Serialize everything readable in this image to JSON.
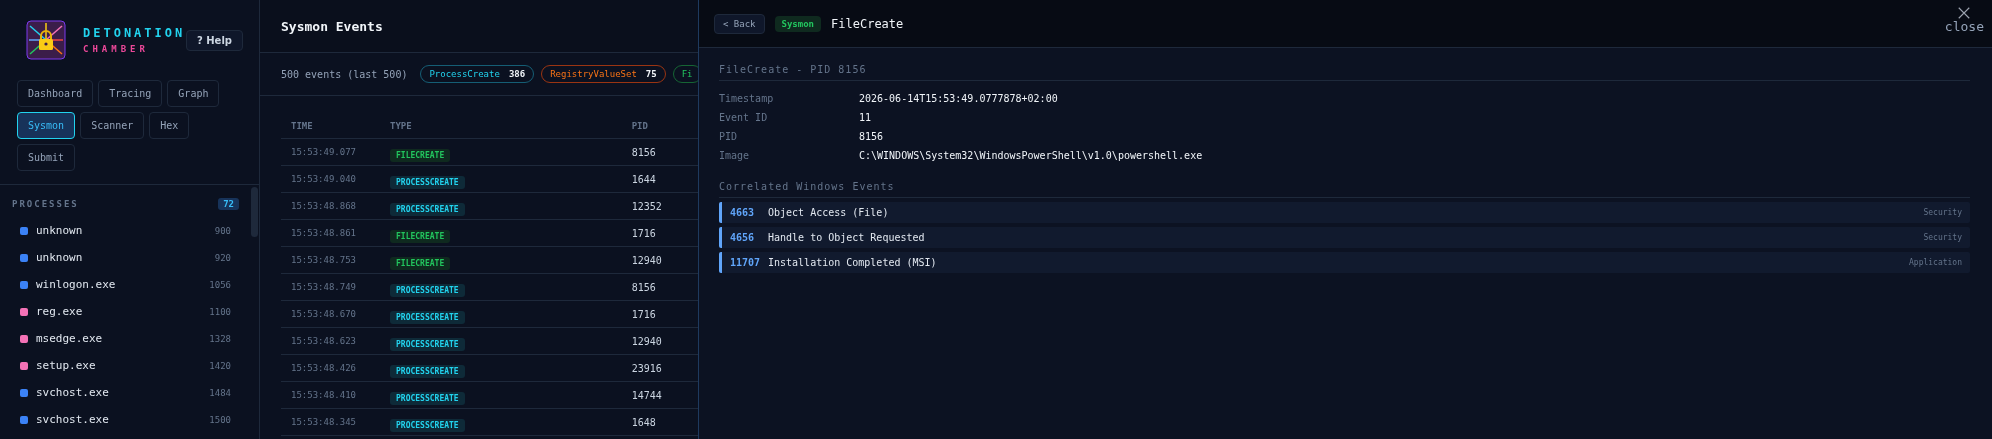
{
  "sidebar": {
    "brand": {
      "line1": "DETONATION",
      "line2": "CHAMBER"
    },
    "help_button": "? Help",
    "nav": [
      {
        "label": "Dashboard",
        "selected": false
      },
      {
        "label": "Tracing",
        "selected": false
      },
      {
        "label": "Graph",
        "selected": false
      },
      {
        "label": "Sysmon",
        "selected": true
      },
      {
        "label": "Scanner",
        "selected": false
      },
      {
        "label": "Hex",
        "selected": false
      },
      {
        "label": "Submit",
        "selected": false
      }
    ],
    "processes": {
      "title": "PROCESSES",
      "count": "72",
      "items": [
        {
          "name": "unknown",
          "pid": "900",
          "color": "#3b82f6"
        },
        {
          "name": "unknown",
          "pid": "920",
          "color": "#3b82f6"
        },
        {
          "name": "winlogon.exe",
          "pid": "1056",
          "color": "#3b82f6"
        },
        {
          "name": "reg.exe",
          "pid": "1100",
          "color": "#f472b6"
        },
        {
          "name": "msedge.exe",
          "pid": "1328",
          "color": "#f472b6"
        },
        {
          "name": "setup.exe",
          "pid": "1420",
          "color": "#f472b6"
        },
        {
          "name": "svchost.exe",
          "pid": "1484",
          "color": "#3b82f6"
        },
        {
          "name": "svchost.exe",
          "pid": "1500",
          "color": "#3b82f6"
        }
      ]
    }
  },
  "events": {
    "title": "Sysmon Events",
    "summary": "500 events (last 500)",
    "filters": [
      {
        "label": "ProcessCreate",
        "count": "386",
        "kind": "process"
      },
      {
        "label": "RegistryValueSet",
        "count": "75",
        "kind": "registry"
      },
      {
        "label": "Fi",
        "kind": "file"
      }
    ],
    "table": {
      "columns": [
        "TIME",
        "TYPE",
        "PID"
      ],
      "rows": [
        {
          "time": "15:53:49.077",
          "type": "FILECREATE",
          "kind": "file",
          "pid": "8156"
        },
        {
          "time": "15:53:49.040",
          "type": "PROCESSCREATE",
          "kind": "process",
          "pid": "1644"
        },
        {
          "time": "15:53:48.868",
          "type": "PROCESSCREATE",
          "kind": "process",
          "pid": "12352"
        },
        {
          "time": "15:53:48.861",
          "type": "FILECREATE",
          "kind": "file",
          "pid": "1716"
        },
        {
          "time": "15:53:48.753",
          "type": "FILECREATE",
          "kind": "file",
          "pid": "12940"
        },
        {
          "time": "15:53:48.749",
          "type": "PROCESSCREATE",
          "kind": "process",
          "pid": "8156"
        },
        {
          "time": "15:53:48.670",
          "type": "PROCESSCREATE",
          "kind": "process",
          "pid": "1716"
        },
        {
          "time": "15:53:48.623",
          "type": "PROCESSCREATE",
          "kind": "process",
          "pid": "12940"
        },
        {
          "time": "15:53:48.426",
          "type": "PROCESSCREATE",
          "kind": "process",
          "pid": "23916"
        },
        {
          "time": "15:53:48.410",
          "type": "PROCESSCREATE",
          "kind": "process",
          "pid": "14744"
        },
        {
          "time": "15:53:48.345",
          "type": "PROCESSCREATE",
          "kind": "process",
          "pid": "1648"
        }
      ]
    }
  },
  "detail": {
    "back_button": "< Back",
    "source_badge": "Sysmon",
    "title": "FileCreate",
    "close_label": "close",
    "section_title": "FileCreate - PID 8156",
    "fields": [
      {
        "label": "Timestamp",
        "value": "2026-06-14T15:53:49.0777878+02:00"
      },
      {
        "label": "Event ID",
        "value": "11"
      },
      {
        "label": "PID",
        "value": "8156"
      },
      {
        "label": "Image",
        "value": "C:\\WINDOWS\\System32\\WindowsPowerShell\\v1.0\\powershell.exe"
      }
    ],
    "correlated_title": "Correlated Windows Events",
    "correlated": [
      {
        "id": "4663",
        "name": "Object Access (File)",
        "log": "Security"
      },
      {
        "id": "4656",
        "name": "Handle to Object Requested",
        "log": "Security"
      },
      {
        "id": "11707",
        "name": "Installation Completed (MSI)",
        "log": "Application"
      }
    ]
  }
}
